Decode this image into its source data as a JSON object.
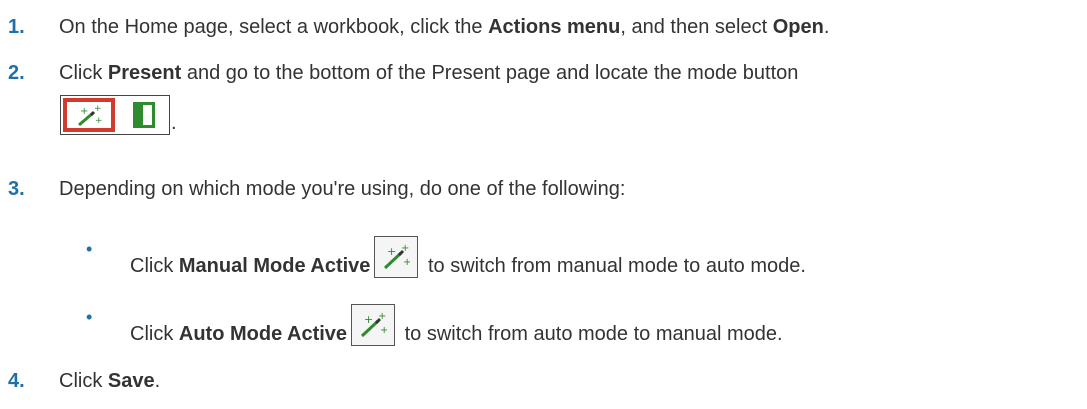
{
  "steps": [
    {
      "number": "1.",
      "pre": "On the Home page, select a workbook, click the ",
      "bold1": "Actions menu",
      "mid": ", and then select ",
      "bold2": "Open",
      "post": "."
    },
    {
      "number": "2.",
      "pre": "Click ",
      "bold1": "Present",
      "post": " and go to the bottom of the Present page and locate the mode button",
      "tail": "."
    },
    {
      "number": "3.",
      "text": "Depending on which mode you're using, do one of the following:",
      "bullets": [
        {
          "pre": "Click ",
          "bold": "Manual Mode Active",
          "post": " to switch from manual mode to auto mode."
        },
        {
          "pre": "Click ",
          "bold": "Auto Mode Active",
          "post": " to switch from auto mode to manual mode."
        }
      ]
    },
    {
      "number": "4.",
      "pre": "Click ",
      "bold1": "Save",
      "post": "."
    }
  ],
  "bullet_char": "•",
  "icons": {
    "wand": "magic-wand-icon",
    "panel": "panel-icon"
  },
  "colors": {
    "step_number": "#1f6fa8",
    "highlight_border": "#d23b2b",
    "wand_green": "#2e8b2e"
  }
}
